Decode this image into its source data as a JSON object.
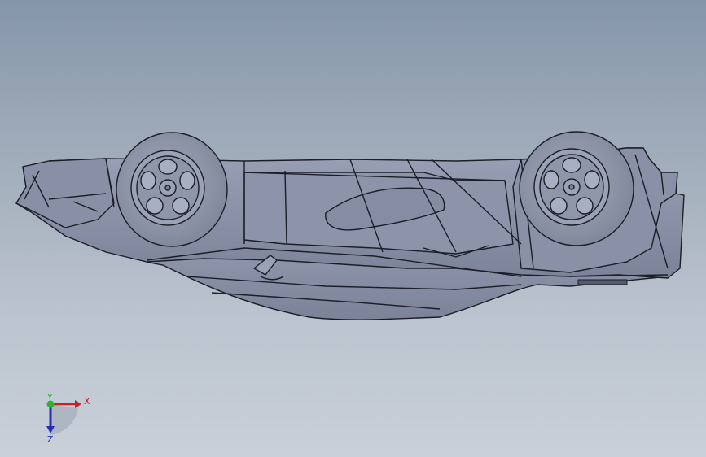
{
  "viewport": {
    "background_top": "#8596a9",
    "background_bottom": "#c9d0d9",
    "model": {
      "icon": "car-body-icon",
      "body_fill": "#8f96ab",
      "edge_color": "#1b1e28"
    }
  },
  "triad": {
    "x_label": "X",
    "y_label": "Y",
    "z_label": "Z",
    "x_color": "#c8202a",
    "y_color": "#2cb52c",
    "z_color": "#2430b0"
  }
}
